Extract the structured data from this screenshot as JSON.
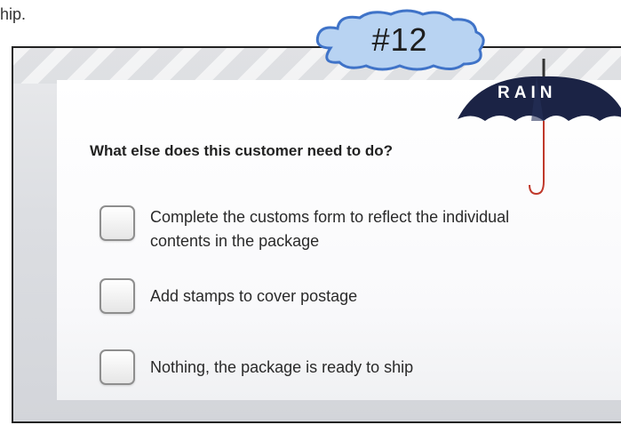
{
  "top_text": "hip.",
  "badge": {
    "label": "#12"
  },
  "logo": {
    "text": "RAIN"
  },
  "question": "What else does this customer need to do?",
  "options": [
    {
      "label": "Complete the customs form to reflect the individual contents in the package",
      "checked": false
    },
    {
      "label": "Add stamps to cover postage",
      "checked": false
    },
    {
      "label": "Nothing, the package is ready to ship",
      "checked": false
    }
  ],
  "colors": {
    "cloud_fill": "#b8d3f2",
    "cloud_stroke": "#3f73c8",
    "umbrella": "#1b2345",
    "accent_red": "#c0392b"
  }
}
